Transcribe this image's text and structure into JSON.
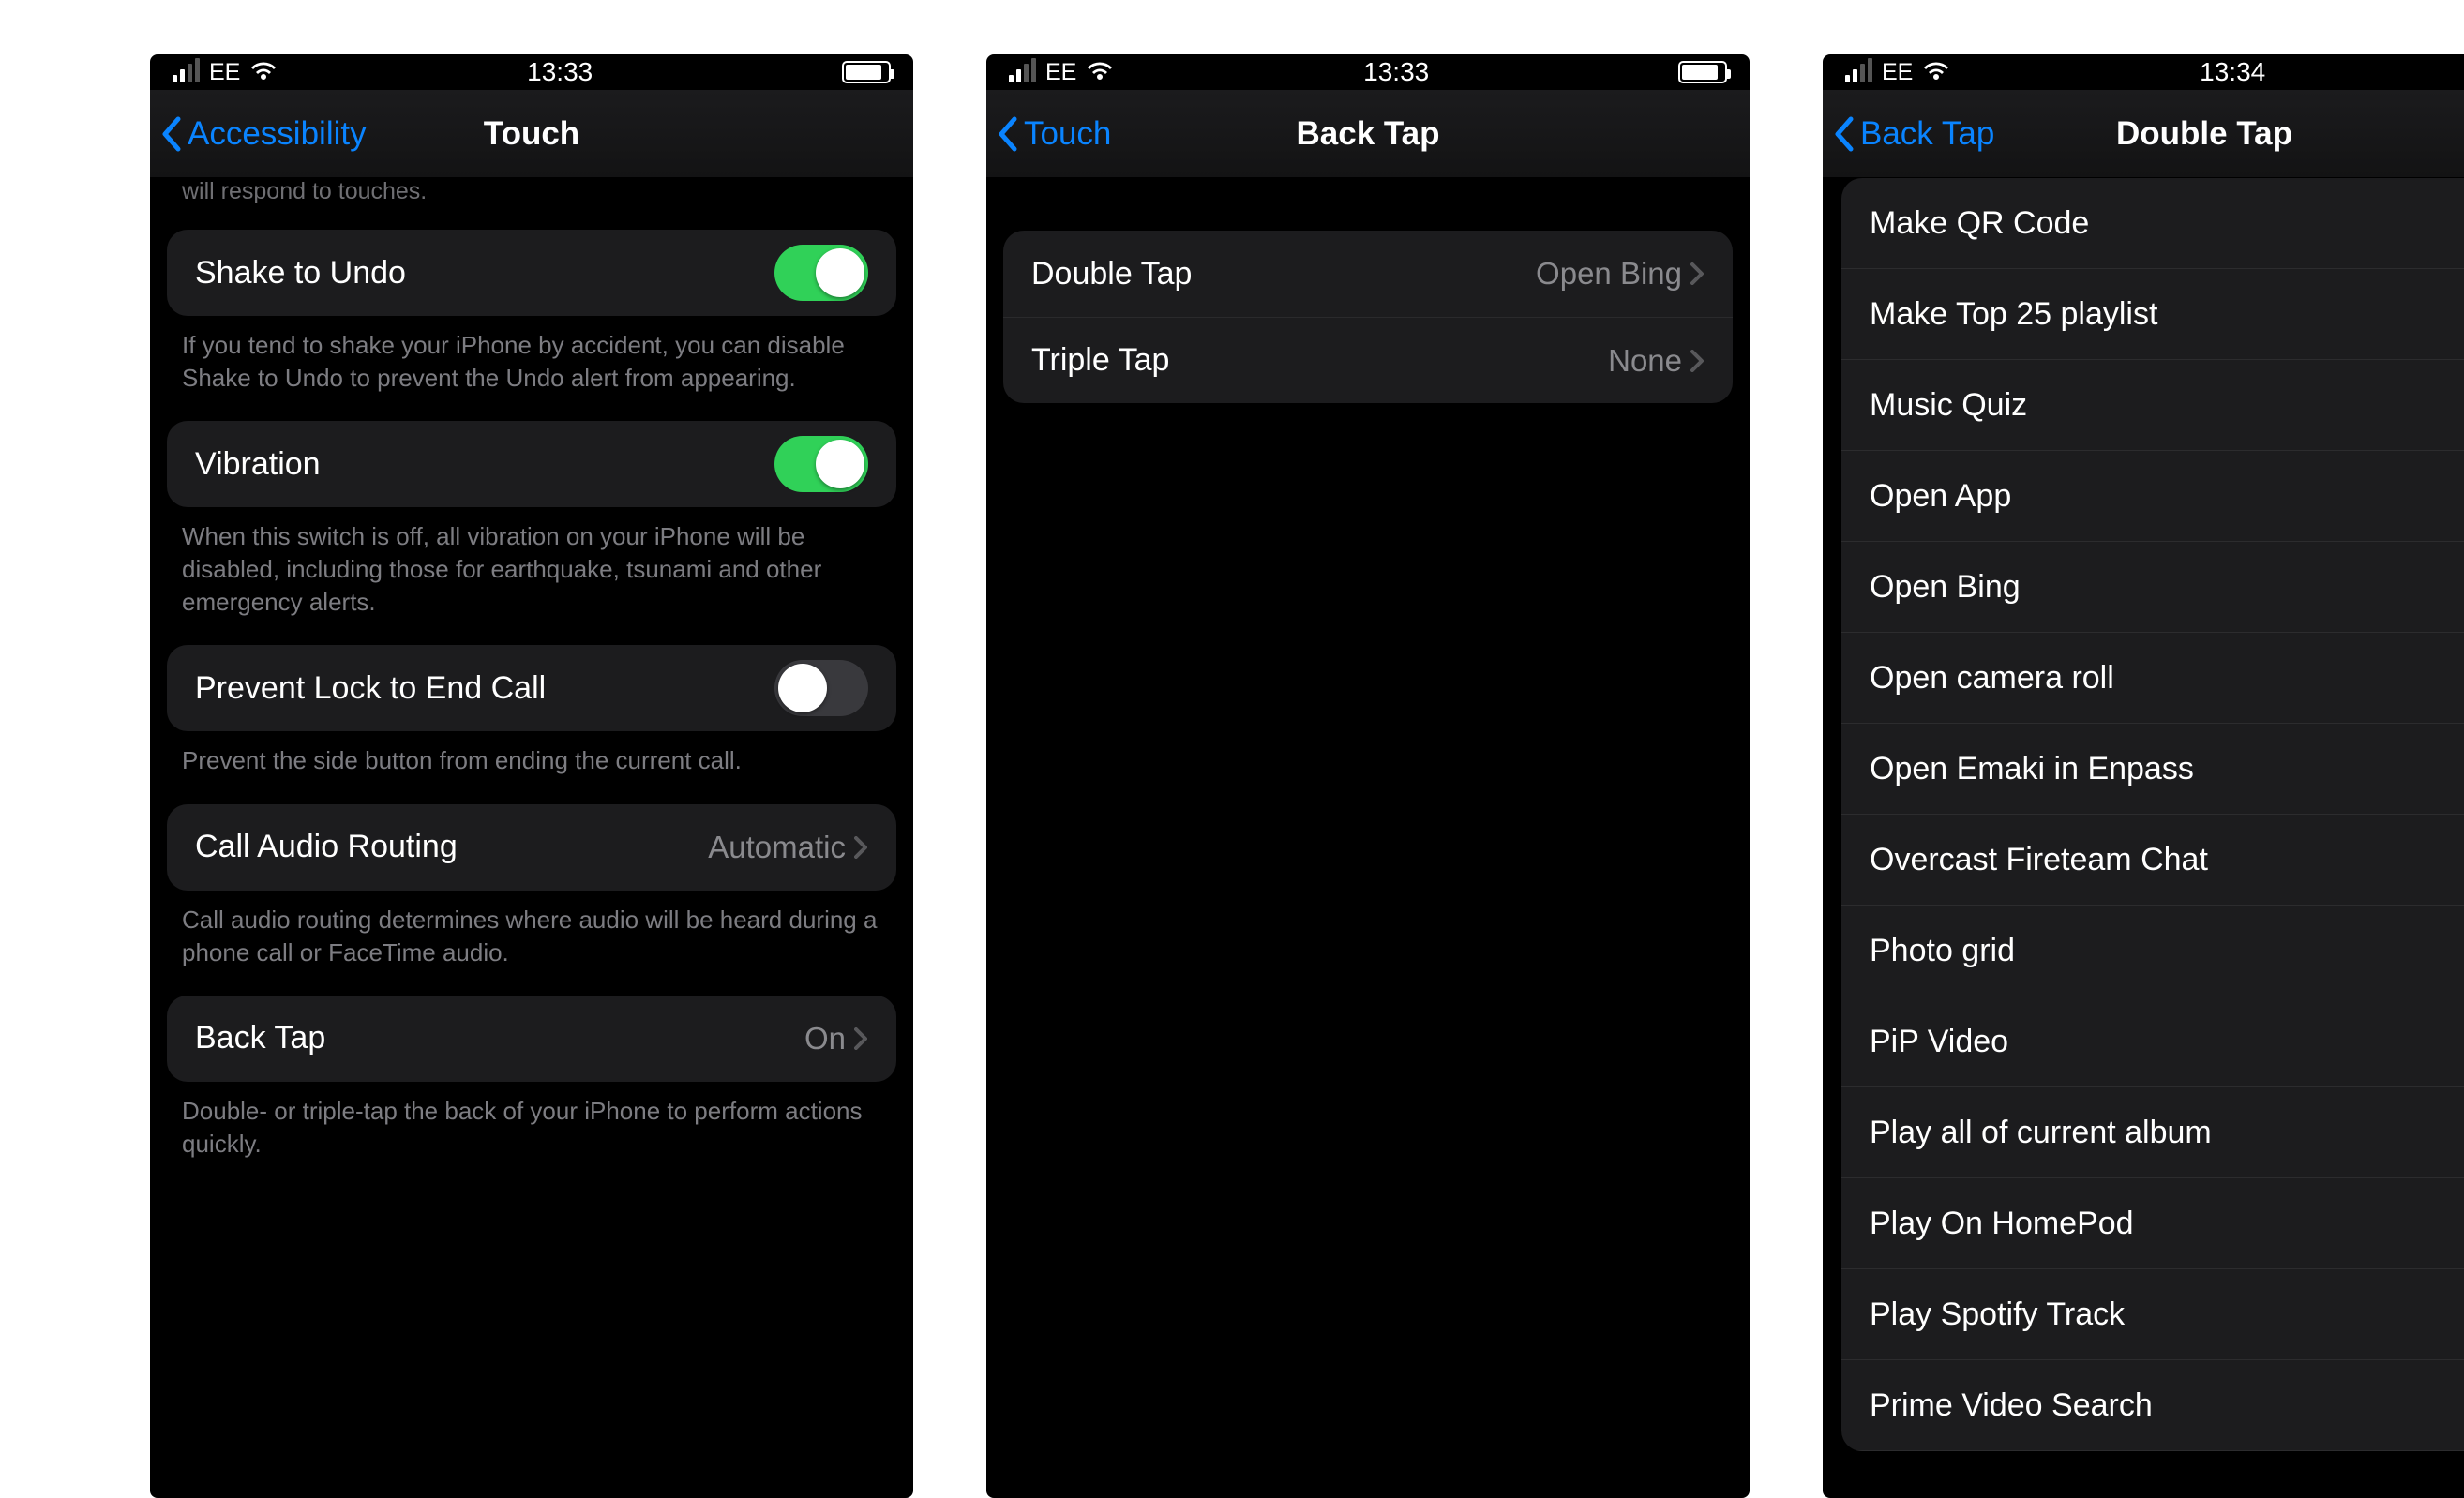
{
  "status": {
    "carrier": "EE",
    "time_a": "13:33",
    "time_b": "13:33",
    "time_c": "13:34"
  },
  "colors": {
    "accent": "#0a84ff",
    "toggle_on": "#30d158"
  },
  "screen1": {
    "back_label": "Accessibility",
    "title": "Touch",
    "cut_top_line": "will respond to touches.",
    "shake": {
      "label": "Shake to Undo",
      "footer": "If you tend to shake your iPhone by accident, you can disable Shake to Undo to prevent the Undo alert from appearing.",
      "on": true
    },
    "vibration": {
      "label": "Vibration",
      "footer": "When this switch is off, all vibration on your iPhone will be disabled, including those for earthquake, tsunami and other emergency alerts.",
      "on": true
    },
    "prevent_lock": {
      "label": "Prevent Lock to End Call",
      "footer": "Prevent the side button from ending the current call.",
      "on": false
    },
    "call_routing": {
      "label": "Call Audio Routing",
      "value": "Automatic",
      "footer": "Call audio routing determines where audio will be heard during a phone call or FaceTime audio."
    },
    "back_tap": {
      "label": "Back Tap",
      "value": "On",
      "footer": "Double- or triple-tap the back of your iPhone to perform actions quickly."
    }
  },
  "screen2": {
    "back_label": "Touch",
    "title": "Back Tap",
    "double": {
      "label": "Double Tap",
      "value": "Open Bing"
    },
    "triple": {
      "label": "Triple Tap",
      "value": "None"
    }
  },
  "screen3": {
    "back_label": "Back Tap",
    "title": "Double Tap",
    "selected_index": 4,
    "items": [
      "Make QR Code",
      "Make Top 25 playlist",
      "Music Quiz",
      "Open App",
      "Open Bing",
      "Open camera roll",
      "Open Emaki in Enpass",
      "Overcast Fireteam Chat",
      "Photo grid",
      "PiP Video",
      "Play all of current album",
      "Play On HomePod",
      "Play Spotify Track",
      "Prime Video Search"
    ]
  }
}
